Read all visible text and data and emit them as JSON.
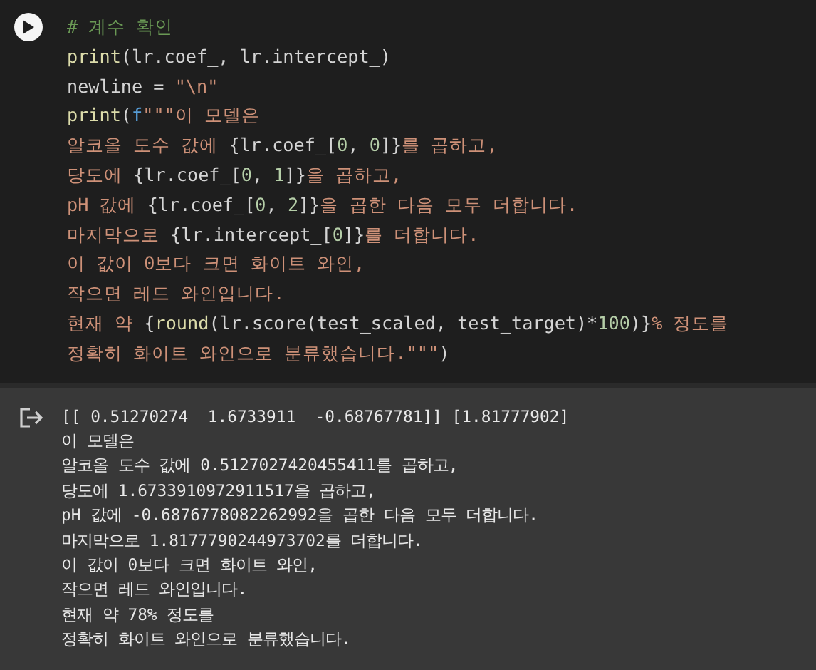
{
  "code_cell": {
    "lines": [
      [
        {
          "kind": "comment",
          "text": "# 계수 확인"
        }
      ],
      [
        {
          "kind": "function",
          "text": "print"
        },
        {
          "kind": "plain",
          "text": "(lr.coef_, lr.intercept_)"
        }
      ],
      [
        {
          "kind": "plain",
          "text": "newline = "
        },
        {
          "kind": "string",
          "text": "\"\\n\""
        }
      ],
      [
        {
          "kind": "function",
          "text": "print"
        },
        {
          "kind": "plain",
          "text": "("
        },
        {
          "kind": "prefix",
          "text": "f"
        },
        {
          "kind": "string",
          "text": "\"\"\"이 모델은"
        }
      ],
      [
        {
          "kind": "string",
          "text": "알코올 도수 값에 "
        },
        {
          "kind": "plain",
          "text": "{lr.coef_["
        },
        {
          "kind": "number",
          "text": "0"
        },
        {
          "kind": "plain",
          "text": ", "
        },
        {
          "kind": "number",
          "text": "0"
        },
        {
          "kind": "plain",
          "text": "]}"
        },
        {
          "kind": "string",
          "text": "를 곱하고,"
        }
      ],
      [
        {
          "kind": "string",
          "text": "당도에 "
        },
        {
          "kind": "plain",
          "text": "{lr.coef_["
        },
        {
          "kind": "number",
          "text": "0"
        },
        {
          "kind": "plain",
          "text": ", "
        },
        {
          "kind": "number",
          "text": "1"
        },
        {
          "kind": "plain",
          "text": "]}"
        },
        {
          "kind": "string",
          "text": "을 곱하고,"
        }
      ],
      [
        {
          "kind": "string",
          "text": "pH 값에 "
        },
        {
          "kind": "plain",
          "text": "{lr.coef_["
        },
        {
          "kind": "number",
          "text": "0"
        },
        {
          "kind": "plain",
          "text": ", "
        },
        {
          "kind": "number",
          "text": "2"
        },
        {
          "kind": "plain",
          "text": "]}"
        },
        {
          "kind": "string",
          "text": "을 곱한 다음 모두 더합니다."
        }
      ],
      [
        {
          "kind": "string",
          "text": "마지막으로 "
        },
        {
          "kind": "plain",
          "text": "{lr.intercept_["
        },
        {
          "kind": "number",
          "text": "0"
        },
        {
          "kind": "plain",
          "text": "]}"
        },
        {
          "kind": "string",
          "text": "를 더합니다."
        }
      ],
      [
        {
          "kind": "string",
          "text": "이 값이 0보다 크면 화이트 와인,"
        }
      ],
      [
        {
          "kind": "string",
          "text": "작으면 레드 와인입니다."
        }
      ],
      [
        {
          "kind": "string",
          "text": "현재 약 "
        },
        {
          "kind": "plain",
          "text": "{"
        },
        {
          "kind": "function",
          "text": "round"
        },
        {
          "kind": "plain",
          "text": "(lr.score(test_scaled, test_target)*"
        },
        {
          "kind": "number",
          "text": "100"
        },
        {
          "kind": "plain",
          "text": ")}"
        },
        {
          "kind": "string",
          "text": "% 정도를"
        }
      ],
      [
        {
          "kind": "string",
          "text": "정확히 화이트 와인으로 분류했습니다.\"\"\""
        },
        {
          "kind": "plain",
          "text": ")"
        }
      ]
    ]
  },
  "output": {
    "lines": [
      "[[ 0.51270274  1.6733911  -0.68767781]] [1.81777902]",
      "이 모델은",
      "알코올 도수 값에 0.5127027420455411를 곱하고,",
      "당도에 1.6733910972911517을 곱하고,",
      "pH 값에 -0.6876778082262992을 곱한 다음 모두 더합니다.",
      "마지막으로 1.8177790244973702를 더합니다.",
      "이 값이 0보다 크면 화이트 와인,",
      "작으면 레드 와인입니다.",
      "현재 약 78% 정도를",
      "정확히 화이트 와인으로 분류했습니다."
    ]
  }
}
